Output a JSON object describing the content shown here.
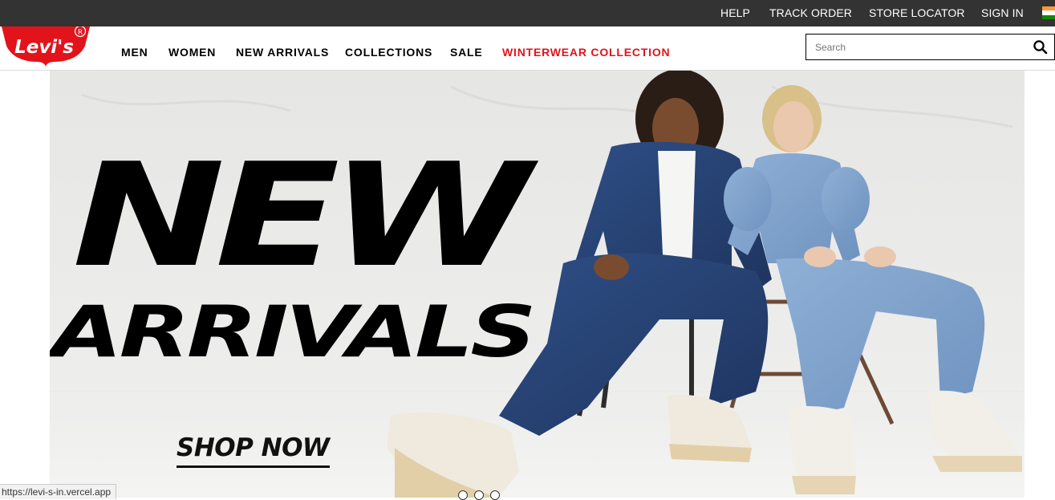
{
  "topbar": {
    "links": [
      "HELP",
      "TRACK ORDER",
      "STORE LOCATOR",
      "SIGN IN"
    ],
    "flag_icon": "india-flag-icon",
    "bg_color": "#333333"
  },
  "header": {
    "logo_text": "Levi's",
    "logo_mark": "®",
    "nav": [
      "MEN",
      "WOMEN",
      "NEW ARRIVALS",
      "COLLECTIONS",
      "SALE",
      "WINTERWEAR COLLECTION"
    ],
    "highlight_color": "#e3131b",
    "search": {
      "placeholder": "Search",
      "value": "",
      "icon": "search-icon"
    }
  },
  "hero": {
    "headline_line1": "NEW",
    "headline_line2": "ARRIVALS",
    "cta": "SHOP NOW",
    "carousel_dots": 3
  },
  "status_bar": {
    "url": "https://levi-s-in.vercel.app"
  }
}
